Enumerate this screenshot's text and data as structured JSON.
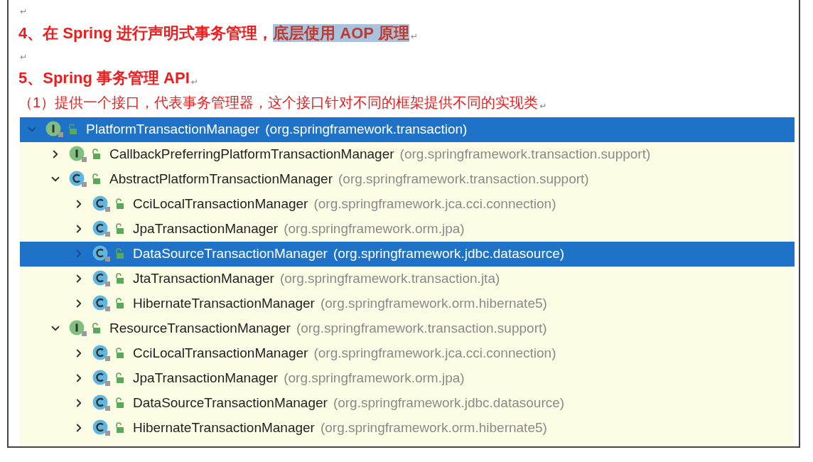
{
  "document": {
    "paragraphs": [
      {
        "kind": "empty",
        "mark": "↵"
      },
      {
        "kind": "heading",
        "mark": "↵",
        "segments": [
          {
            "text": "4、在 Spring 进行声明式事务管理，",
            "selected": false
          },
          {
            "text": "底层使用 AOP 原理",
            "selected": true
          }
        ]
      },
      {
        "kind": "empty",
        "mark": "↵"
      },
      {
        "kind": "heading",
        "mark": "↵",
        "segments": [
          {
            "text": "5、Spring 事务管理 API",
            "selected": false
          }
        ]
      },
      {
        "kind": "body",
        "mark": "↵",
        "segments": [
          {
            "text": "（1）提供一个接口，代表事务管理器，这个接口针对不同的框架提供不同的实现类",
            "selected": false
          }
        ]
      }
    ]
  },
  "hierarchy": {
    "items": [
      {
        "kind": "interface",
        "name": "PlatformTransactionManager",
        "package": "(org.springframework.transaction)",
        "selected": true,
        "expanded": true,
        "children": [
          {
            "kind": "interface",
            "name": "CallbackPreferringPlatformTransactionManager",
            "package": "(org.springframework.transaction.support)",
            "selected": false,
            "expanded": false
          },
          {
            "kind": "class",
            "name": "AbstractPlatformTransactionManager",
            "package": "(org.springframework.transaction.support)",
            "selected": false,
            "expanded": true,
            "children": [
              {
                "kind": "class",
                "name": "CciLocalTransactionManager",
                "package": "(org.springframework.jca.cci.connection)",
                "selected": false,
                "expanded": false
              },
              {
                "kind": "class",
                "name": "JpaTransactionManager",
                "package": "(org.springframework.orm.jpa)",
                "selected": false,
                "expanded": false
              },
              {
                "kind": "class",
                "name": "DataSourceTransactionManager",
                "package": "(org.springframework.jdbc.datasource)",
                "selected": true,
                "expanded": false
              },
              {
                "kind": "class",
                "name": "JtaTransactionManager",
                "package": "(org.springframework.transaction.jta)",
                "selected": false,
                "expanded": false
              },
              {
                "kind": "class",
                "name": "HibernateTransactionManager",
                "package": "(org.springframework.orm.hibernate5)",
                "selected": false,
                "expanded": false
              }
            ]
          },
          {
            "kind": "interface",
            "name": "ResourceTransactionManager",
            "package": "(org.springframework.transaction.support)",
            "selected": false,
            "expanded": true,
            "children": [
              {
                "kind": "class",
                "name": "CciLocalTransactionManager",
                "package": "(org.springframework.jca.cci.connection)",
                "selected": false,
                "expanded": false
              },
              {
                "kind": "class",
                "name": "JpaTransactionManager",
                "package": "(org.springframework.orm.jpa)",
                "selected": false,
                "expanded": false
              },
              {
                "kind": "class",
                "name": "DataSourceTransactionManager",
                "package": "(org.springframework.jdbc.datasource)",
                "selected": false,
                "expanded": false
              },
              {
                "kind": "class",
                "name": "HibernateTransactionManager",
                "package": "(org.springframework.orm.hibernate5)",
                "selected": false,
                "expanded": false
              }
            ]
          }
        ]
      }
    ]
  }
}
